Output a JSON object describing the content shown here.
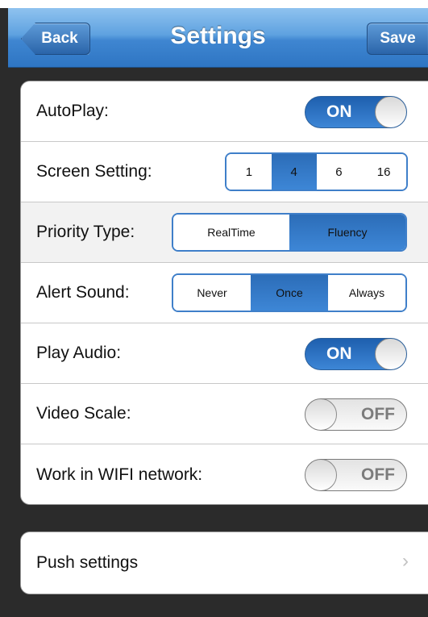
{
  "navbar": {
    "title": "Settings",
    "back_label": "Back",
    "save_label": "Save"
  },
  "settings": {
    "autoplay": {
      "label": "AutoPlay:",
      "state": "ON"
    },
    "screen_setting": {
      "label": "Screen Setting:",
      "options": [
        "1",
        "4",
        "6",
        "16"
      ],
      "selected": "4"
    },
    "priority_type": {
      "label": "Priority Type:",
      "options": [
        "RealTime",
        "Fluency"
      ],
      "selected": "Fluency"
    },
    "alert_sound": {
      "label": "Alert Sound:",
      "options": [
        "Never",
        "Once",
        "Always"
      ],
      "selected": "Once"
    },
    "play_audio": {
      "label": "Play Audio:",
      "state": "ON"
    },
    "video_scale": {
      "label": "Video Scale:",
      "state": "OFF"
    },
    "wifi": {
      "label": "Work in WIFI network:",
      "state": "OFF"
    }
  },
  "push": {
    "label": "Push settings",
    "icon": "chevron-right-icon"
  },
  "colors": {
    "nav": "#3f86d1",
    "accent": "#2c6db8",
    "background": "#2b2b2b"
  }
}
